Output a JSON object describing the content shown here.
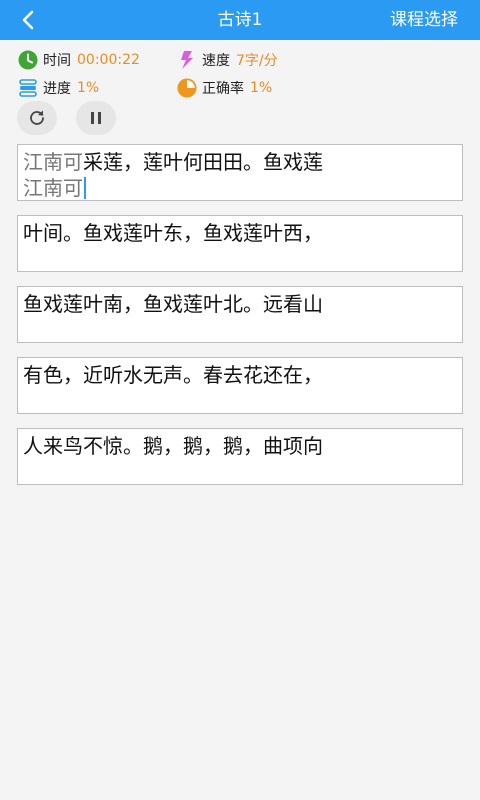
{
  "header": {
    "title": "古诗1",
    "course_select": "课程选择"
  },
  "stats": {
    "time": {
      "label": "时间",
      "value": "00:00:22"
    },
    "speed": {
      "label": "速度",
      "value": "7字/分"
    },
    "progress": {
      "label": "进度",
      "value": "1%"
    },
    "accuracy": {
      "label": "正确率",
      "value": "1%"
    }
  },
  "colors": {
    "accent": "#2a9af3",
    "value": "#f08a24",
    "time_icon": "#3fa535",
    "speed_icon": "#e05adf",
    "progress_icon": "#2a9af3",
    "accuracy_icon": "#f0961e"
  },
  "icons": {
    "back": "chevron-left-icon",
    "time": "clock-icon",
    "speed": "lightning-icon",
    "progress": "stack-icon",
    "accuracy": "pie-chart-icon",
    "reset": "refresh-icon",
    "pause": "pause-icon"
  },
  "lines": [
    {
      "typed_prefix": "江南可",
      "rest": "采莲，莲叶何田田。鱼戏莲",
      "input": "江南可"
    },
    {
      "text": "叶间。鱼戏莲叶东，鱼戏莲叶西，"
    },
    {
      "text": "鱼戏莲叶南，鱼戏莲叶北。远看山"
    },
    {
      "text": "有色，近听水无声。春去花还在，"
    },
    {
      "text": "人来鸟不惊。鹅，鹅，鹅，曲项向"
    }
  ]
}
